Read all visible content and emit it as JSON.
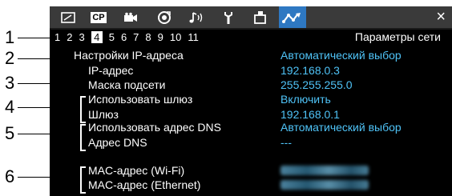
{
  "tabs": [
    {
      "icon": "frame-icon",
      "active": false
    },
    {
      "icon": "cp-icon",
      "text": "CP",
      "active": false
    },
    {
      "icon": "camera-icon",
      "active": false
    },
    {
      "icon": "assistance-icon",
      "active": false
    },
    {
      "icon": "audio-icon",
      "active": false
    },
    {
      "icon": "wrench-icon",
      "active": false
    },
    {
      "icon": "monitor-icon",
      "active": false
    },
    {
      "icon": "network-icon",
      "active": true
    }
  ],
  "close_label": "×",
  "pages": [
    "1",
    "2",
    "3",
    "4",
    "5",
    "6",
    "7",
    "8",
    "9",
    "10",
    "11"
  ],
  "current_page": "4",
  "page_title": "Параметры сети",
  "settings": [
    {
      "label": "Настройки IP-адреса",
      "value": "Автоматический выбор"
    },
    {
      "label": "IP-адрес",
      "value": "192.168.0.3"
    },
    {
      "label": "Маска подсети",
      "value": "255.255.255.0"
    },
    {
      "label": "Использовать шлюз",
      "value": "Включить"
    },
    {
      "label": "Шлюз",
      "value": "192.168.0.1"
    },
    {
      "label": "Использовать адрес DNS",
      "value": "Автоматический выбор"
    },
    {
      "label": "Адрес DNS",
      "value": "---"
    },
    {
      "label": "MAC-адрес (Wi-Fi)",
      "value": ""
    },
    {
      "label": "MAC-адрес (Ethernet)",
      "value": ""
    }
  ],
  "callouts": [
    "1",
    "2",
    "3",
    "4",
    "5",
    "6"
  ],
  "value_color": "#4fc3f7",
  "active_tab_color": "#2e78c2"
}
